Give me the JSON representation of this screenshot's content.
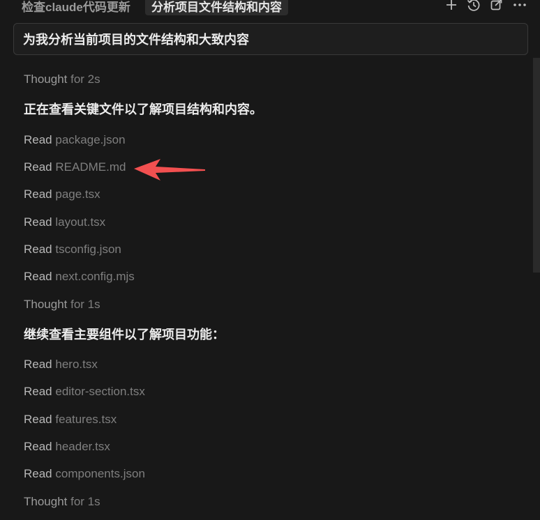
{
  "tabs": [
    {
      "label": "检查claude代码更新",
      "active": false
    },
    {
      "label": "分析项目文件结构和内容",
      "active": true
    }
  ],
  "toolbar": {
    "icons": [
      "plus-icon",
      "history-icon",
      "share-icon",
      "more-icon"
    ]
  },
  "prompt": {
    "text": "为我分析当前项目的文件结构和大致内容"
  },
  "log": [
    {
      "kind": "thought",
      "keyword": "Thought",
      "arg": "for 2s"
    },
    {
      "kind": "message",
      "text": "正在查看关键文件以了解项目结构和内容。"
    },
    {
      "kind": "read",
      "keyword": "Read",
      "arg": "package.json"
    },
    {
      "kind": "read",
      "keyword": "Read",
      "arg": "README.md"
    },
    {
      "kind": "read",
      "keyword": "Read",
      "arg": "page.tsx"
    },
    {
      "kind": "read",
      "keyword": "Read",
      "arg": "layout.tsx"
    },
    {
      "kind": "read",
      "keyword": "Read",
      "arg": "tsconfig.json"
    },
    {
      "kind": "read",
      "keyword": "Read",
      "arg": "next.config.mjs"
    },
    {
      "kind": "thought",
      "keyword": "Thought",
      "arg": "for 1s"
    },
    {
      "kind": "message",
      "text": "继续查看主要组件以了解项目功能："
    },
    {
      "kind": "read",
      "keyword": "Read",
      "arg": "hero.tsx"
    },
    {
      "kind": "read",
      "keyword": "Read",
      "arg": "editor-section.tsx"
    },
    {
      "kind": "read",
      "keyword": "Read",
      "arg": "features.tsx"
    },
    {
      "kind": "read",
      "keyword": "Read",
      "arg": "header.tsx"
    },
    {
      "kind": "read",
      "keyword": "Read",
      "arg": "components.json"
    },
    {
      "kind": "thought",
      "keyword": "Thought",
      "arg": "for 1s"
    }
  ],
  "colors": {
    "background": "#181818",
    "annotation_arrow": "#f25050"
  }
}
